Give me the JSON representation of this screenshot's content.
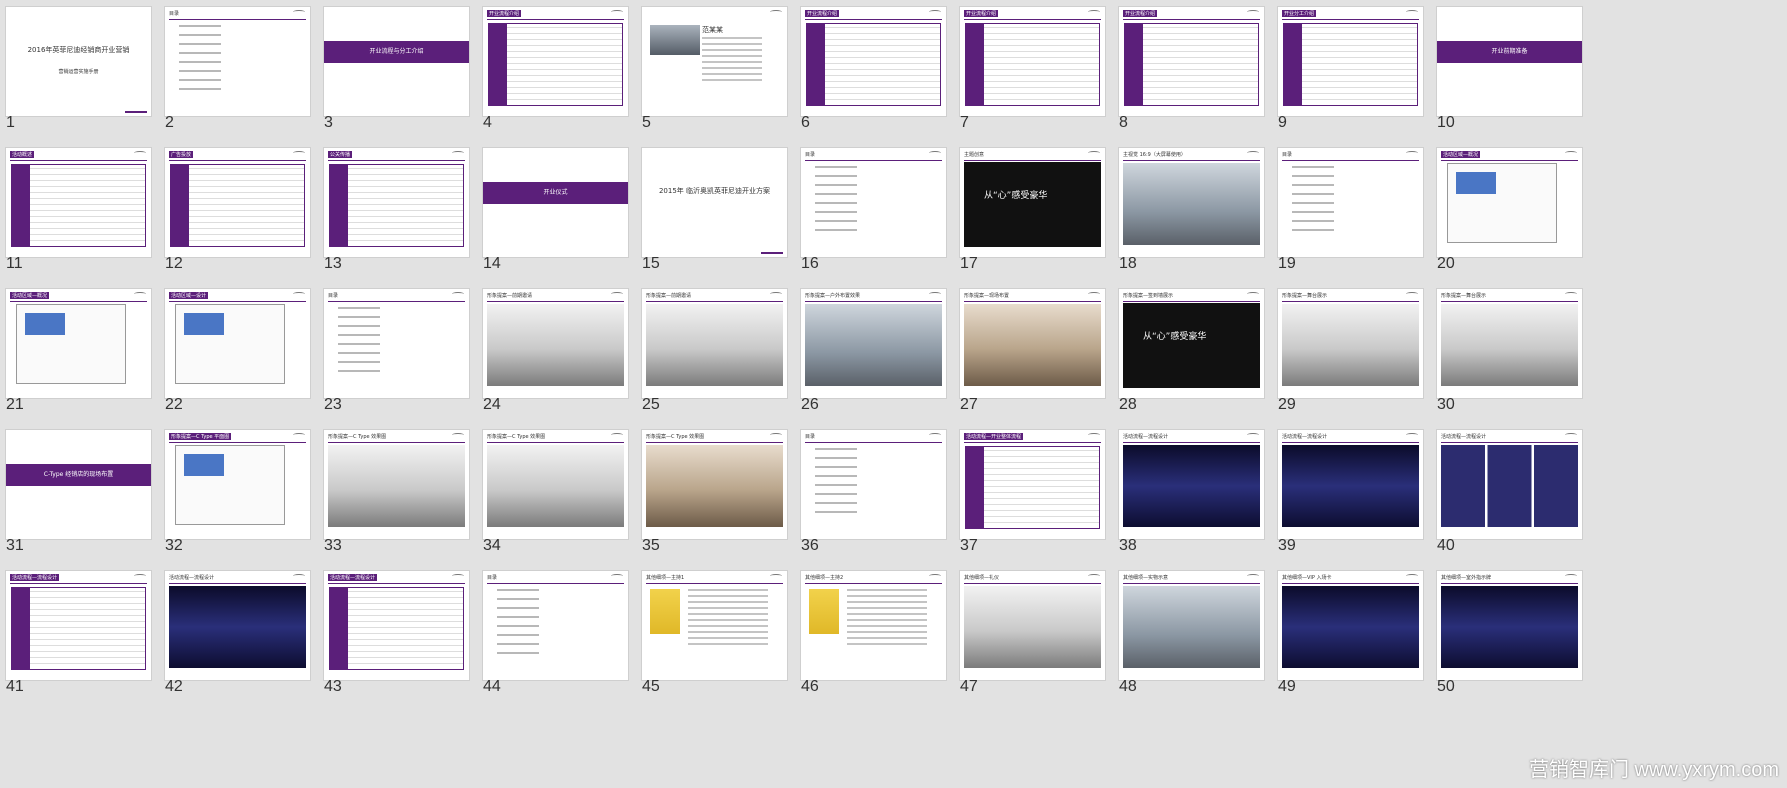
{
  "slides": [
    {
      "n": "1",
      "kind": "title",
      "title": "2016年英菲尼迪经销商开业营销",
      "sub": "营销运营实施手册"
    },
    {
      "n": "2",
      "kind": "toc",
      "head": "目录"
    },
    {
      "n": "3",
      "kind": "band",
      "band": "开业流程与分工介绍"
    },
    {
      "n": "4",
      "kind": "table",
      "head": "开业流程介绍"
    },
    {
      "n": "5",
      "kind": "profile",
      "head": "",
      "name": "范某某"
    },
    {
      "n": "6",
      "kind": "table",
      "head": "开业流程介绍"
    },
    {
      "n": "7",
      "kind": "table",
      "head": "开业流程介绍"
    },
    {
      "n": "8",
      "kind": "table",
      "head": "开业流程介绍"
    },
    {
      "n": "9",
      "kind": "table",
      "head": "开业分工介绍"
    },
    {
      "n": "10",
      "kind": "band",
      "band": "开业前期准备"
    },
    {
      "n": "11",
      "kind": "table",
      "head": "活动概述"
    },
    {
      "n": "12",
      "kind": "table",
      "head": "广告投放"
    },
    {
      "n": "13",
      "kind": "table",
      "head": "公关传播"
    },
    {
      "n": "14",
      "kind": "band",
      "band": "开业仪式"
    },
    {
      "n": "15",
      "kind": "title",
      "title": "2015年 临沂奥凯英菲尼迪开业方案",
      "sub": ""
    },
    {
      "n": "16",
      "kind": "toc",
      "head": "目录"
    },
    {
      "n": "17",
      "kind": "dark",
      "head": "主题创意",
      "headline": "从“心”感受豪华"
    },
    {
      "n": "18",
      "kind": "photo",
      "style": "",
      "head": "主视觉 16:9（大屏幕使用）"
    },
    {
      "n": "19",
      "kind": "toc",
      "head": "目录"
    },
    {
      "n": "20",
      "kind": "plan",
      "head": "活动区域—概况"
    },
    {
      "n": "21",
      "kind": "plan",
      "head": "活动区域—概况"
    },
    {
      "n": "22",
      "kind": "plan",
      "head": "活动区域—设计"
    },
    {
      "n": "23",
      "kind": "toc",
      "head": "目录"
    },
    {
      "n": "24",
      "kind": "photo",
      "style": "stage",
      "head": "形象提案—前期邀请"
    },
    {
      "n": "25",
      "kind": "photo",
      "style": "stage",
      "head": "形象提案—前期邀请"
    },
    {
      "n": "26",
      "kind": "photo",
      "style": "",
      "head": "形象提案—户外布置效果"
    },
    {
      "n": "27",
      "kind": "photo",
      "style": "warm",
      "head": "形象提案—现场布置"
    },
    {
      "n": "28",
      "kind": "dark",
      "head": "形象提案—签到墙展示",
      "headline": "从“心”感受豪华"
    },
    {
      "n": "29",
      "kind": "photo",
      "style": "stage",
      "head": "形象提案—舞台展示"
    },
    {
      "n": "30",
      "kind": "photo",
      "style": "stage",
      "head": "形象提案—舞台展示"
    },
    {
      "n": "31",
      "kind": "band",
      "band": "C-Type 经销店的现场布置"
    },
    {
      "n": "32",
      "kind": "plan",
      "head": "形象提案—C Type 平面图"
    },
    {
      "n": "33",
      "kind": "photo",
      "style": "stage",
      "head": "形象提案—C Type 效果图"
    },
    {
      "n": "34",
      "kind": "photo",
      "style": "stage",
      "head": "形象提案—C Type 效果图"
    },
    {
      "n": "35",
      "kind": "photo",
      "style": "warm",
      "head": "形象提案—C Type 效果图"
    },
    {
      "n": "36",
      "kind": "toc",
      "head": "目录"
    },
    {
      "n": "37",
      "kind": "table",
      "head": "活动流程—开业整体流程"
    },
    {
      "n": "38",
      "kind": "photo",
      "style": "blue",
      "head": "活动流程—流程设计"
    },
    {
      "n": "39",
      "kind": "photo",
      "style": "blue",
      "head": "活动流程—流程设计"
    },
    {
      "n": "40",
      "kind": "photo",
      "style": "grid6",
      "head": "活动流程—流程设计"
    },
    {
      "n": "41",
      "kind": "table",
      "head": "活动流程—流程设计"
    },
    {
      "n": "42",
      "kind": "photo",
      "style": "blue",
      "head": "活动流程—流程设计"
    },
    {
      "n": "43",
      "kind": "table",
      "head": "活动流程—流程设计"
    },
    {
      "n": "44",
      "kind": "toc",
      "head": "目录"
    },
    {
      "n": "45",
      "kind": "person",
      "head": "其他细项—主持1"
    },
    {
      "n": "46",
      "kind": "person",
      "head": "其他细项—主持2"
    },
    {
      "n": "47",
      "kind": "photo",
      "style": "stage",
      "head": "其他细项—礼仪"
    },
    {
      "n": "48",
      "kind": "photo",
      "style": "",
      "head": "其他细项—实物示意"
    },
    {
      "n": "49",
      "kind": "photo",
      "style": "blue",
      "head": "其他细项—VIP 入场卡"
    },
    {
      "n": "50",
      "kind": "photo",
      "style": "blue",
      "head": "其他细项—室外指示牌"
    }
  ],
  "watermark": "营销智库门 www.yxrym.com"
}
